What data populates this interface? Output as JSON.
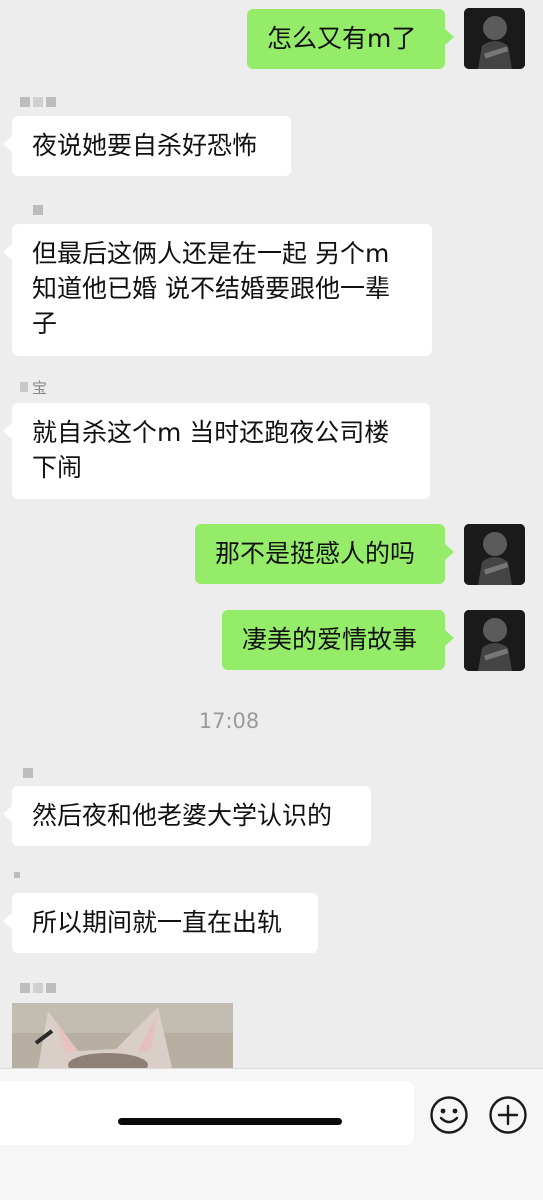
{
  "messages": [
    {
      "side": "out",
      "text": "怎么又有m了"
    },
    {
      "side": "in",
      "text": "夜说她要自杀好恐怖"
    },
    {
      "side": "in",
      "text": "但最后这俩人还是在一起 另个m知道他已婚 说不结婚要跟他一辈子"
    },
    {
      "side": "in",
      "text": "就自杀这个m 当时还跑夜公司楼下闹"
    },
    {
      "side": "out",
      "text": "那不是挺感人的吗"
    },
    {
      "side": "out",
      "text": "凄美的爱情故事"
    },
    {
      "side": "in",
      "text": "然后夜和他老婆大学认识的"
    },
    {
      "side": "in",
      "text": "所以期间就一直在出轨"
    }
  ],
  "timestamp": "17:08",
  "partial_sender_name": "宝",
  "icons": {
    "emoji": "smiley-face-icon",
    "add": "plus-circle-icon"
  },
  "colors": {
    "background": "#ededed",
    "incoming_bubble": "#ffffff",
    "outgoing_bubble": "#95ec69",
    "input_bar": "#f6f6f6"
  }
}
